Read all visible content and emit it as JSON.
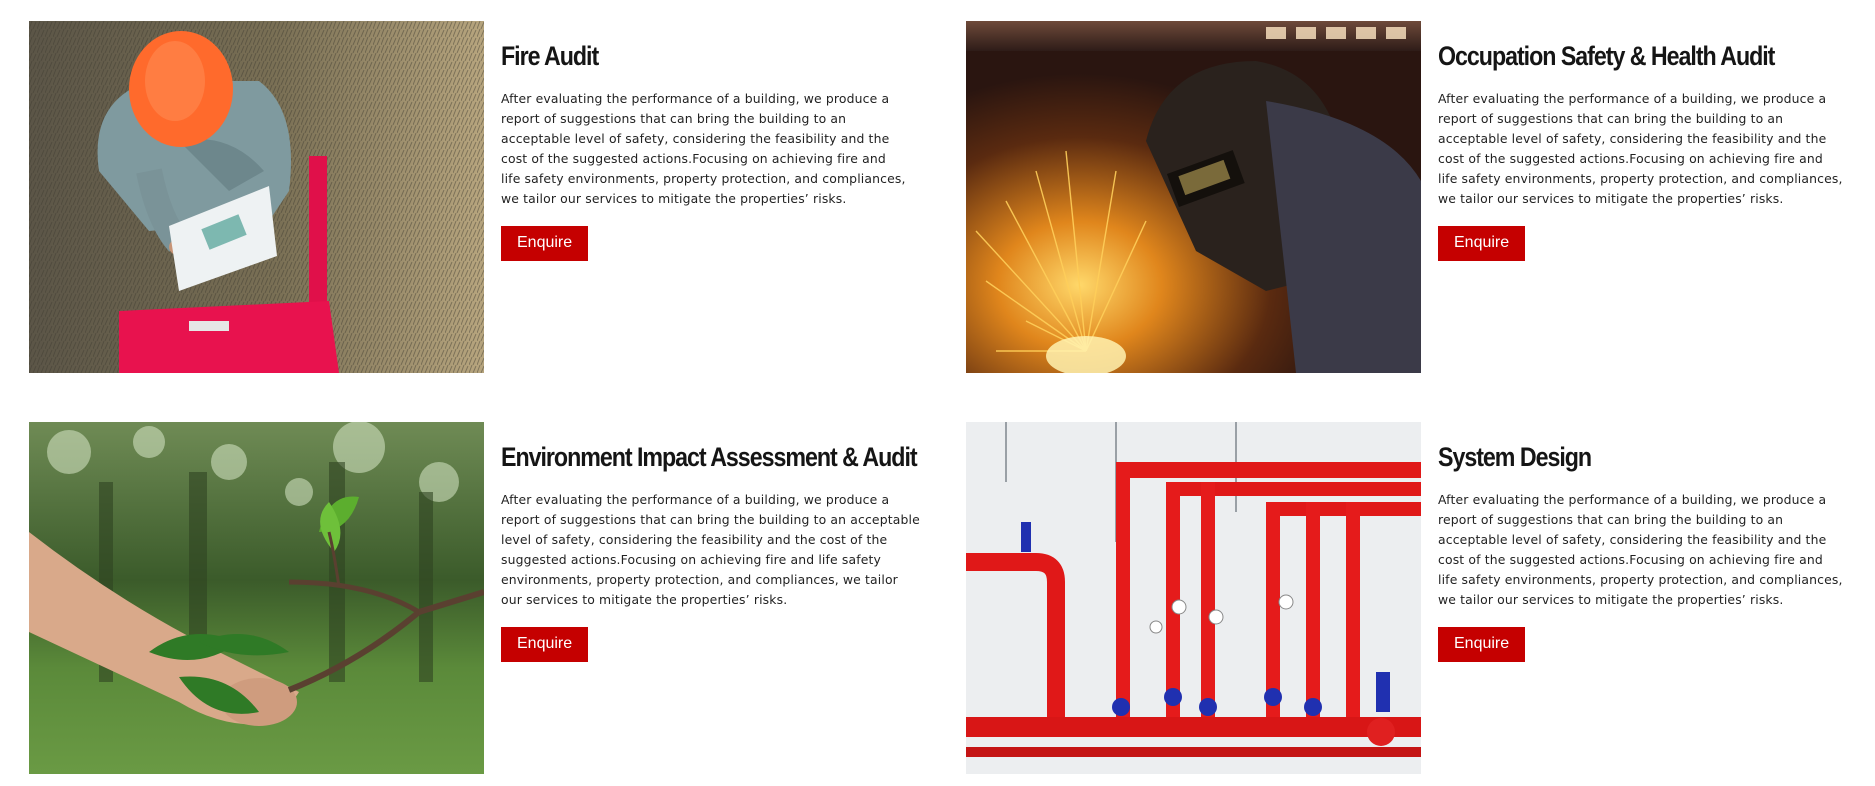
{
  "services": [
    {
      "title": "Fire Audit",
      "description": "After evaluating the performance of a building, we produce a report of suggestions that can bring the building to an acceptable level of safety, considering the feasibility and the cost of the suggested actions.Focusing on achieving fire and life safety environments, property protection, and compliances, we tailor our services to mitigate the properties’ risks.",
      "button_label": "Enquire",
      "image": "worker-with-hard-hat-and-checklist-photo"
    },
    {
      "title": "Occupation Safety & Health Audit",
      "description": "After evaluating the performance of a building, we produce a report of suggestions that can bring the building to an acceptable level of safety, considering the feasibility and the cost of the suggested actions.Focusing on achieving fire and life safety environments, property protection, and compliances, we tailor our services to mitigate the properties’ risks.",
      "button_label": "Enquire",
      "image": "welder-with-sparks-photo"
    },
    {
      "title": "Environment Impact Assessment & Audit",
      "description": "After evaluating the performance of a building, we produce a report of suggestions that can bring the building to an acceptable level of safety, considering the feasibility and the cost of the suggested actions.Focusing on achieving fire and life safety environments, property protection, and compliances, we tailor our services to mitigate the properties’ risks.",
      "button_label": "Enquire",
      "image": "hand-holding-branch-with-leaves-photo"
    },
    {
      "title": "System Design",
      "description": "After evaluating the performance of a building, we produce a report of suggestions that can bring the building to an acceptable level of safety, considering the feasibility and the cost of the suggested actions.Focusing on achieving fire and life safety environments, property protection, and compliances, we tailor our services to mitigate the properties’ risks.",
      "button_label": "Enquire",
      "image": "red-fire-sprinkler-pipes-photo"
    }
  ],
  "colors": {
    "button_bg": "#c50000",
    "button_text": "#ffffff",
    "title_text": "#151515",
    "body_text": "#222222"
  }
}
